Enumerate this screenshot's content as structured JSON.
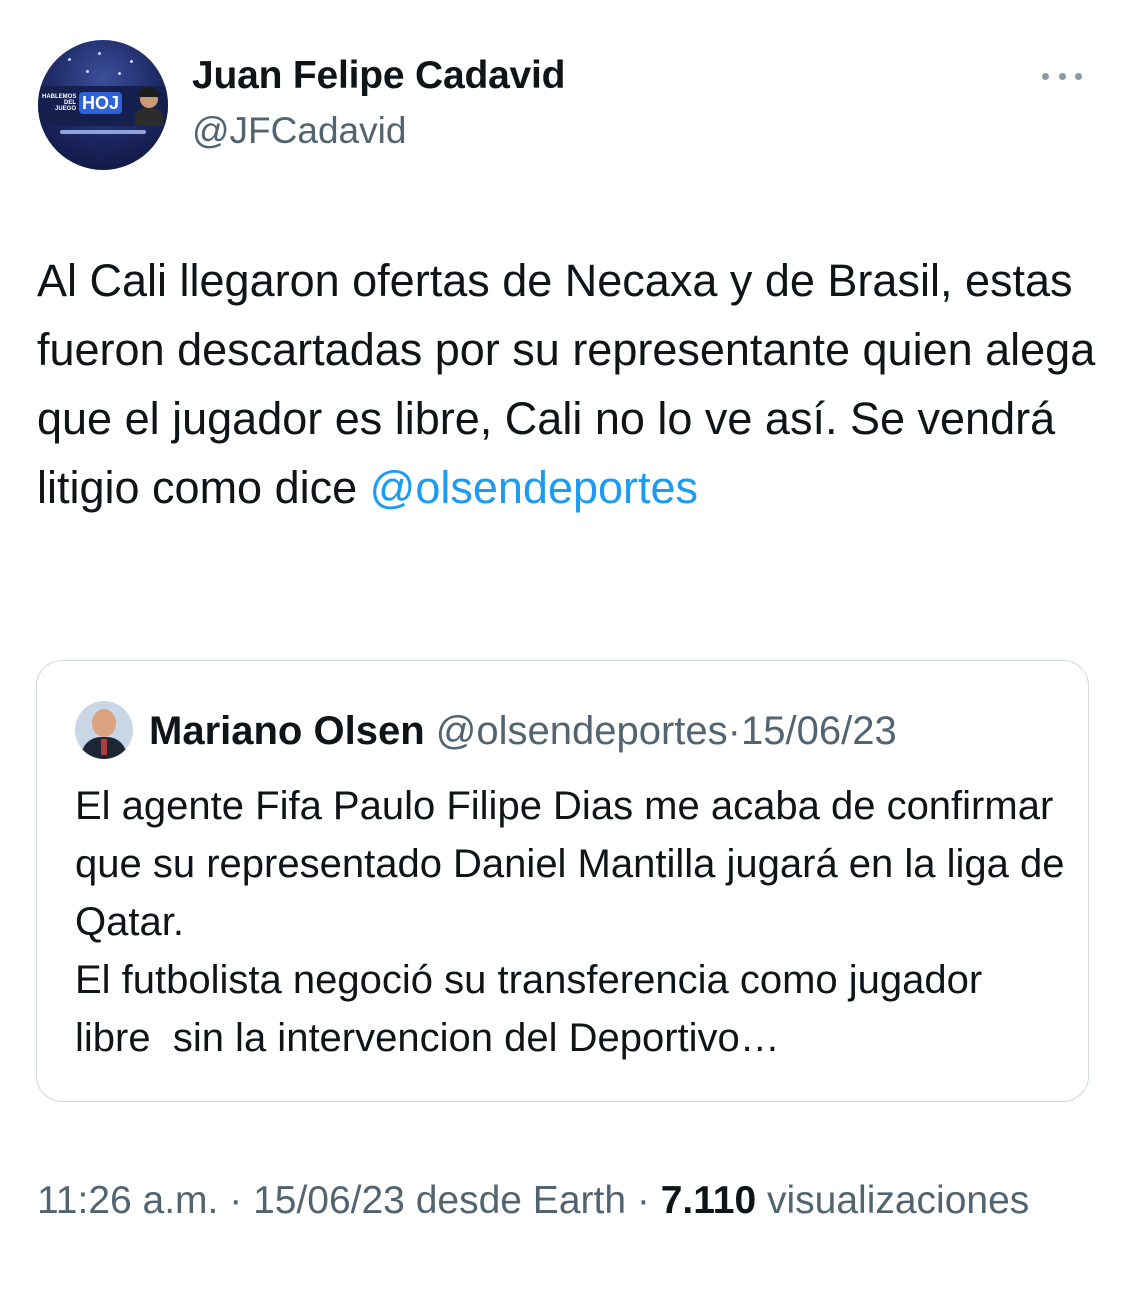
{
  "author": {
    "display_name": "Juan Felipe Cadavid",
    "handle": "@JFCadavid",
    "avatar_logo_small": "HABLEMOS DEL JUEGO",
    "avatar_logo_big": "HOJ"
  },
  "more_icon": "more-horizontal-icon",
  "tweet": {
    "text_before_mention": "Al Cali llegaron ofertas de Necaxa y de Brasil, estas fueron descartadas por su representante quien alega que el jugador es libre, Cali no lo ve así. Se vendrá litigio como dice ",
    "mention": "@olsendeportes"
  },
  "quoted_tweet": {
    "display_name": "Mariano Olsen",
    "handle": "@olsendeportes",
    "separator": "·",
    "date": "15/06/23",
    "text": "El agente Fifa Paulo Filipe Dias me acaba de confirmar que su representado Daniel Mantilla jugará en la liga de Qatar.\nEl futbolista negoció su transferencia como jugador libre  sin la intervencion del Deportivo…"
  },
  "meta": {
    "time": "11:26 a.m.",
    "separator1": " · ",
    "date": "15/06/23",
    "source": " desde Earth",
    "separator2": " · ",
    "views_count": "7.110",
    "views_label": " visualizaciones"
  },
  "colors": {
    "link": "#1d9bf0",
    "secondary_text": "#536471",
    "primary_text": "#0f1419",
    "border": "#cfd9de"
  }
}
